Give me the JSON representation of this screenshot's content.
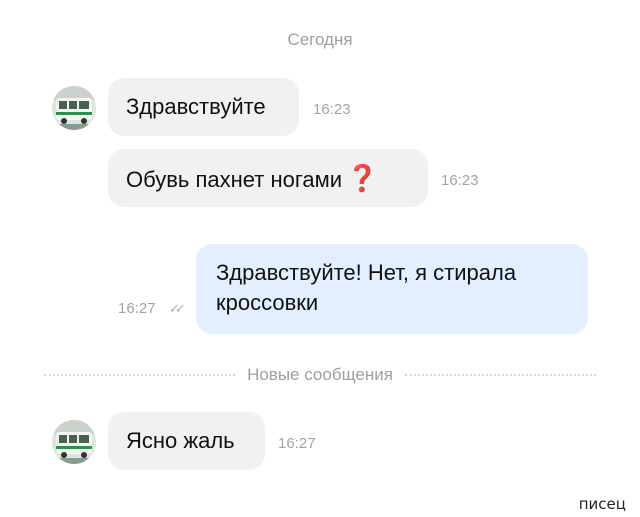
{
  "chat": {
    "date_label": "Сегодня",
    "messages": [
      {
        "text": "Здравствуйте",
        "time": "16:23",
        "direction": "incoming"
      },
      {
        "text": "Обувь пахнет ногами",
        "emoji": "❓",
        "time": "16:23",
        "direction": "incoming"
      },
      {
        "text_line1": "Здравствуйте! Нет, я стирала",
        "text_line2": "кроссовки",
        "time": "16:27",
        "direction": "outgoing",
        "status_icon": "double-check-icon"
      },
      {
        "text": "Ясно жаль",
        "time": "16:27",
        "direction": "incoming"
      }
    ],
    "new_messages_label": "Новые сообщения"
  },
  "avatar_icon": "bus-icon",
  "watermark": "писец",
  "colors": {
    "incoming_bubble": "#f1f1f3",
    "outgoing_bubble": "#e3eefe",
    "meta_text": "#9aa0a6",
    "question_mark": "#e02c2c",
    "read_ticks": "#9fb6d9"
  }
}
